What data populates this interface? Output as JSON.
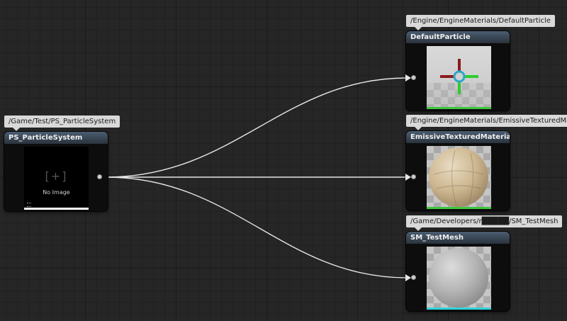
{
  "source_node": {
    "path": "/Game/Test/PS_ParticleSystem",
    "title": "PS_ParticleSystem",
    "thumbnail_text": "No Image",
    "thumbnail_glyph": "[+]"
  },
  "target_nodes": [
    {
      "path": "/Engine/EngineMaterials/DefaultParticle",
      "title": "DefaultParticle",
      "thumbnail": "particle-gizmo",
      "bar_color": "#3cc63c"
    },
    {
      "path": "/Engine/EngineMaterials/EmissiveTexturedMaterial",
      "title": "EmissiveTexturedMaterial",
      "thumbnail": "textured-sphere",
      "bar_color": "#3cc63c"
    },
    {
      "path": "/Game/Developers/r█████/SM_TestMesh",
      "title": "SM_TestMesh",
      "thumbnail": "gray-sphere",
      "bar_color": "#2fd3d8"
    }
  ],
  "colors": {
    "header": "#4b5d70",
    "wire": "#e6e6e6",
    "background": "#262626"
  },
  "icons": [
    "pin-icon",
    "arrow-pin-icon",
    "no-image-icon"
  ]
}
